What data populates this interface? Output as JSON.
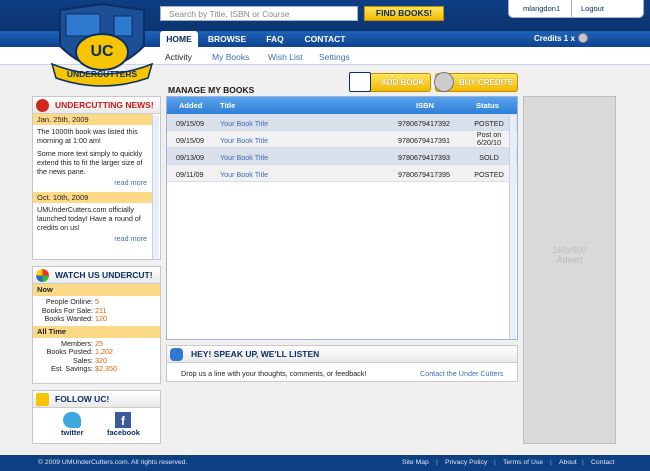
{
  "header": {
    "logo_text": "UC",
    "logo_banner": "UNDERCUTTERS",
    "search_placeholder": "Search by Title, ISBN or Course",
    "find_button": "FIND BOOKS!",
    "username": "mlangdon1",
    "logout": "Logout",
    "credits_label": "Credits",
    "credits_value": "1 x"
  },
  "nav": {
    "tabs": [
      {
        "label": "HOME",
        "active": true
      },
      {
        "label": "BROWSE"
      },
      {
        "label": "FAQ"
      },
      {
        "label": "CONTACT"
      }
    ],
    "subtabs": [
      {
        "label": "Activity",
        "active": true
      },
      {
        "label": "My Books"
      },
      {
        "label": "Wish List"
      },
      {
        "label": "Settings"
      }
    ]
  },
  "news": {
    "title": "UNDERCUTTING NEWS!",
    "items": [
      {
        "date": "Jan. 25th, 2009",
        "text1": "The 1000th book was listed this morning at 1:00 am!",
        "text2": "Some more text simply to quickly extend this to fit the larger size of the news pane.",
        "more": "read more"
      },
      {
        "date": "Oct. 10th, 2009",
        "text1": "UMUnderCutters.com officially launched today!  Have a round of credits on us!",
        "more": "read more"
      }
    ]
  },
  "stats": {
    "title": "WATCH US UNDERCUT!",
    "now_label": "Now",
    "now": [
      {
        "k": "People Online:",
        "v": "5"
      },
      {
        "k": "Books For Sale:",
        "v": "211"
      },
      {
        "k": "Books Wanted:",
        "v": "120"
      }
    ],
    "all_label": "All Time",
    "all": [
      {
        "k": "Members:",
        "v": "25"
      },
      {
        "k": "Books Posted:",
        "v": "1,202"
      },
      {
        "k": "Sales:",
        "v": "320"
      },
      {
        "k": "Est. Savings:",
        "v": "$2,350"
      }
    ]
  },
  "follow": {
    "title": "FOLLOW UC!",
    "twitter": "twitter",
    "facebook": "facebook",
    "facebook_glyph": "f"
  },
  "main": {
    "title": "MANAGE MY BOOKS",
    "add_book": "ADD BOOK",
    "buy_credits": "BUY CREDITS",
    "columns": [
      "Added",
      "Title",
      "ISBN",
      "Status"
    ],
    "rows": [
      {
        "added": "09/15/09",
        "title": "Your Book Title",
        "isbn": "9780679417392",
        "status": "POSTED"
      },
      {
        "added": "09/15/09",
        "title": "Your Book Title",
        "isbn": "9780679417391",
        "status": "Post on 6/20/10"
      },
      {
        "added": "09/13/09",
        "title": "Your Book Title",
        "isbn": "9780679417393",
        "status": "SOLD"
      },
      {
        "added": "09/11/09",
        "title": "Your Book Title",
        "isbn": "9780679417395",
        "status": "POSTED"
      }
    ]
  },
  "speak": {
    "title": "HEY! SPEAK UP, WE'LL LISTEN",
    "text": "Drop us a line with your thoughts, comments, or feedback!",
    "link": "Contact the Under Cutters"
  },
  "advert": {
    "line1": "160x600",
    "line2": "Advert"
  },
  "footer": {
    "copyright": "© 2009 UMUnderCutters.com. All rights reserved.",
    "links": [
      "Site Map",
      "Privacy Policy",
      "Terms of Use",
      "About",
      "Contact"
    ]
  }
}
